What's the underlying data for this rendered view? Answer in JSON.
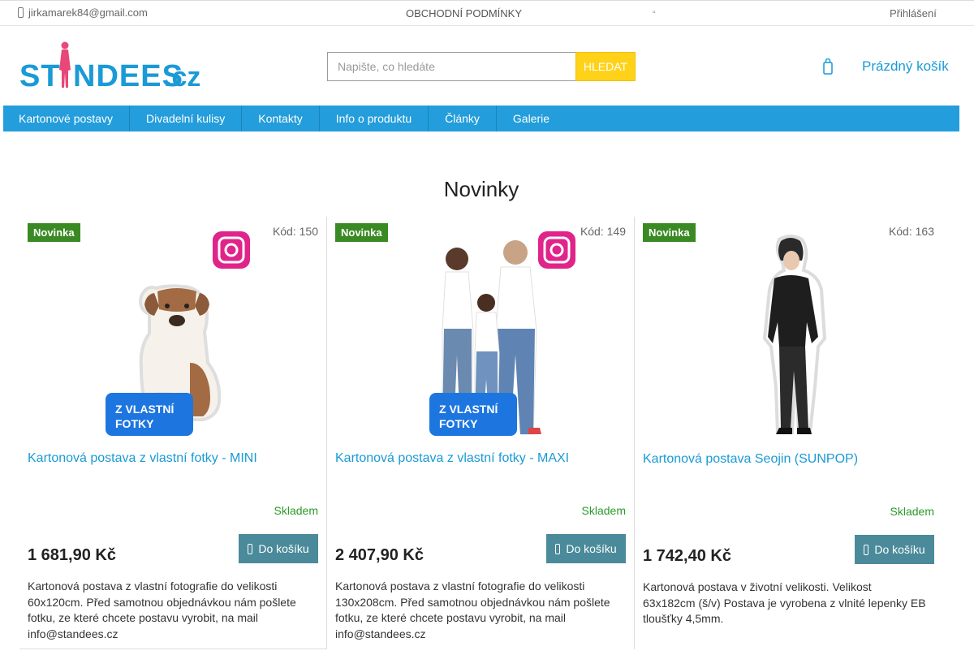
{
  "topbar": {
    "email": "jirkamarek84@gmail.com",
    "terms": "OBCHODNÍ PODMÍNKY",
    "login": "Přihlášení"
  },
  "logo": {
    "text_left": "ST",
    "text_right": "NDEES",
    "text_tld": ".cz",
    "color": "#1a9ad6",
    "accent": "#e8477a"
  },
  "search": {
    "placeholder": "Napište, co hledáte",
    "button": "HLEDAT"
  },
  "cart": {
    "label": "Prázdný košík"
  },
  "nav": {
    "items": [
      {
        "label": "Kartonové postavy"
      },
      {
        "label": "Divadelní kulisy"
      },
      {
        "label": "Kontakty"
      },
      {
        "label": "Info o produktu"
      },
      {
        "label": "Články"
      },
      {
        "label": "Galerie"
      }
    ]
  },
  "section": {
    "title": "Novinky"
  },
  "products": [
    {
      "badge": "Novinka",
      "code": "Kód: 150",
      "image": "dog-standee-icon",
      "overlay": "Z VLASTNÍ FOTKY",
      "title": "Kartonová postava z vlastní fotky - MINI",
      "stock": "Skladem",
      "price": "1 681,90 Kč",
      "button": "Do košíku",
      "description": "Kartonová postava z vlastní fotografie do velikosti 60x120cm. Před samotnou objednávkou nám pošlete fotku, ze které chcete postavu vyrobit, na mail info@standees.cz"
    },
    {
      "badge": "Novinka",
      "code": "Kód: 149",
      "image": "family-standee-icon",
      "overlay": "Z VLASTNÍ FOTKY",
      "title": "Kartonová postava z vlastní fotky - MAXI",
      "stock": "Skladem",
      "price": "2 407,90 Kč",
      "button": "Do košíku",
      "description": "Kartonová postava z vlastní fotografie do velikosti 130x208cm. Před samotnou objednávkou nám pošlete fotku, ze které chcete postavu vyrobit, na mail info@standees.cz"
    },
    {
      "badge": "Novinka",
      "code": "Kód: 163",
      "image": "person-standee-icon",
      "title": "Kartonová postava Seojin (SUNPOP)",
      "stock": "Skladem",
      "price": "1 742,40 Kč",
      "button": "Do košíku",
      "description": "Kartonová postava v životní velikosti. Velikost 63x182cm (š/v) Postava je vyrobena z vlnité lepenky EB tloušťky 4,5mm."
    }
  ]
}
